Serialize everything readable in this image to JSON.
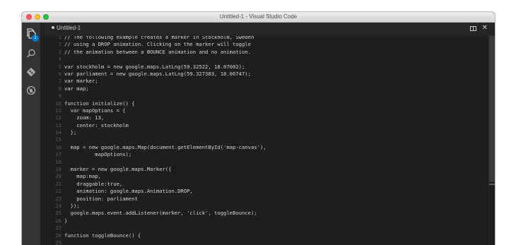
{
  "window": {
    "title": "Untitled-1 - Visual Studio Code"
  },
  "activity_bar": {
    "badge": "1"
  },
  "tab": {
    "label": "Untitled-1"
  },
  "editor": {
    "lines": [
      {
        "n": "1",
        "text": "// The following example creates a marker in Stockholm, Sweden"
      },
      {
        "n": "2",
        "text": "// using a DROP animation. Clicking on the marker will toggle"
      },
      {
        "n": "3",
        "text": "// the animation between a BOUNCE animation and no animation."
      },
      {
        "n": "4",
        "text": ""
      },
      {
        "n": "5",
        "text": "var stockholm = new google.maps.LatLng(59.32522, 18.07002);"
      },
      {
        "n": "6",
        "text": "var parliament = new google.maps.LatLng(59.327383, 18.06747);"
      },
      {
        "n": "7",
        "text": "var marker;"
      },
      {
        "n": "8",
        "text": "var map;"
      },
      {
        "n": "9",
        "text": ""
      },
      {
        "n": "10",
        "text": "function initialize() {"
      },
      {
        "n": "11",
        "text": "  var mapOptions = {"
      },
      {
        "n": "12",
        "text": "    zoom: 13,"
      },
      {
        "n": "13",
        "text": "    center: stockholm"
      },
      {
        "n": "14",
        "text": "  };"
      },
      {
        "n": "15",
        "text": ""
      },
      {
        "n": "16",
        "text": "  map = new google.maps.Map(document.getElementById('map-canvas'),"
      },
      {
        "n": "17",
        "text": "          mapOptions);"
      },
      {
        "n": "18",
        "text": ""
      },
      {
        "n": "19",
        "text": "  marker = new google.maps.Marker({"
      },
      {
        "n": "20",
        "text": "    map:map,"
      },
      {
        "n": "21",
        "text": "    draggable:true,"
      },
      {
        "n": "22",
        "text": "    animation: google.maps.Animation.DROP,"
      },
      {
        "n": "23",
        "text": "    position: parliament"
      },
      {
        "n": "24",
        "text": "  });"
      },
      {
        "n": "25",
        "text": "  google.maps.event.addListener(marker, 'click', toggleBounce);"
      },
      {
        "n": "26",
        "text": "}"
      },
      {
        "n": "27",
        "text": ""
      },
      {
        "n": "28",
        "text": "function toggleBounce() {"
      },
      {
        "n": "29",
        "text": ""
      }
    ]
  }
}
